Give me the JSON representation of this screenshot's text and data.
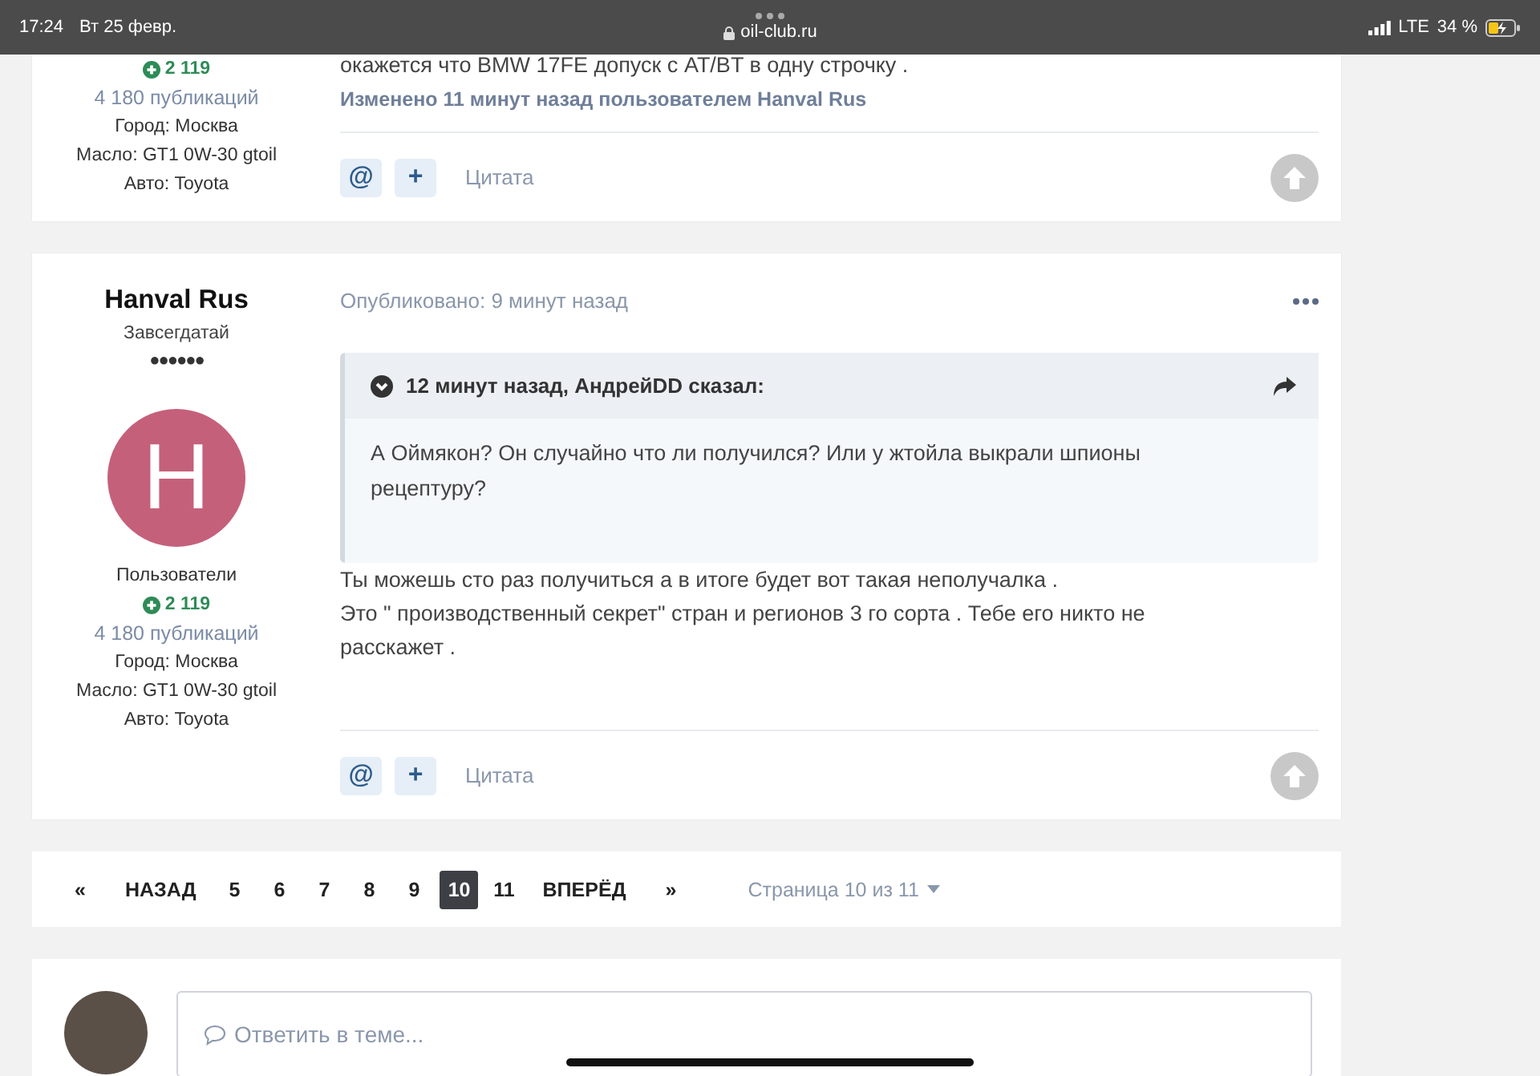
{
  "status_bar": {
    "time": "17:24",
    "date": "Вт 25 февр.",
    "url": "oil-club.ru",
    "network": "LTE",
    "battery": "34 %"
  },
  "posts": [
    {
      "kind": "tail",
      "author": {
        "reputation": "2 119",
        "posts_count": "4 180 публикаций",
        "fields": [
          {
            "label": "Город:",
            "value": "Москва"
          },
          {
            "label": "Масло:",
            "value": "GT1 0W-30 gtoil"
          },
          {
            "label": "Авто:",
            "value": "Toyota"
          }
        ]
      },
      "body": [
        "окажется что BMW 17FE  допуск  с AT/BT  в одну строчку ."
      ],
      "edited": "Изменено 11 минут назад пользователем Hanval Rus",
      "actions": {
        "mention": "@",
        "plus": "+",
        "quote": "Цитата"
      }
    },
    {
      "kind": "full",
      "author": {
        "name": "Hanval Rus",
        "rank": "Завсегдатай",
        "pips": "●●●●●●",
        "initial": "H",
        "group": "Пользователи",
        "reputation": "2 119",
        "posts_count": "4 180 публикаций",
        "fields": [
          {
            "label": "Город:",
            "value": "Москва"
          },
          {
            "label": "Масло:",
            "value": "GT1 0W-30 gtoil"
          },
          {
            "label": "Авто:",
            "value": "Toyota"
          }
        ]
      },
      "posted": "Опубликовано: 9 минут назад",
      "quote": {
        "citation": "12 минут назад, АндрейDD сказал:",
        "text": "А Оймякон? Он случайно что ли получился? Или у жтойла выкрали шпионы рецептуру?"
      },
      "body": [
        "Ты можешь сто раз получиться  а в итоге  будет  вот такая неполучалка .",
        "Это \" производственный секрет\" стран и регионов 3 го сорта . Тебе его никто не расскажет ."
      ],
      "actions": {
        "mention": "@",
        "plus": "+",
        "quote": "Цитата"
      }
    }
  ],
  "pagination": {
    "first": "«",
    "prev": "НАЗАД",
    "pages": [
      {
        "label": "5",
        "selected": false
      },
      {
        "label": "6",
        "selected": false
      },
      {
        "label": "7",
        "selected": false
      },
      {
        "label": "8",
        "selected": false
      },
      {
        "label": "9",
        "selected": false
      },
      {
        "label": "10",
        "selected": true
      },
      {
        "label": "11",
        "selected": false
      }
    ],
    "next": "ВПЕРЁД",
    "last": "»",
    "page_info": "Страница 10 из 11"
  },
  "reply": {
    "placeholder": "Ответить в теме..."
  }
}
